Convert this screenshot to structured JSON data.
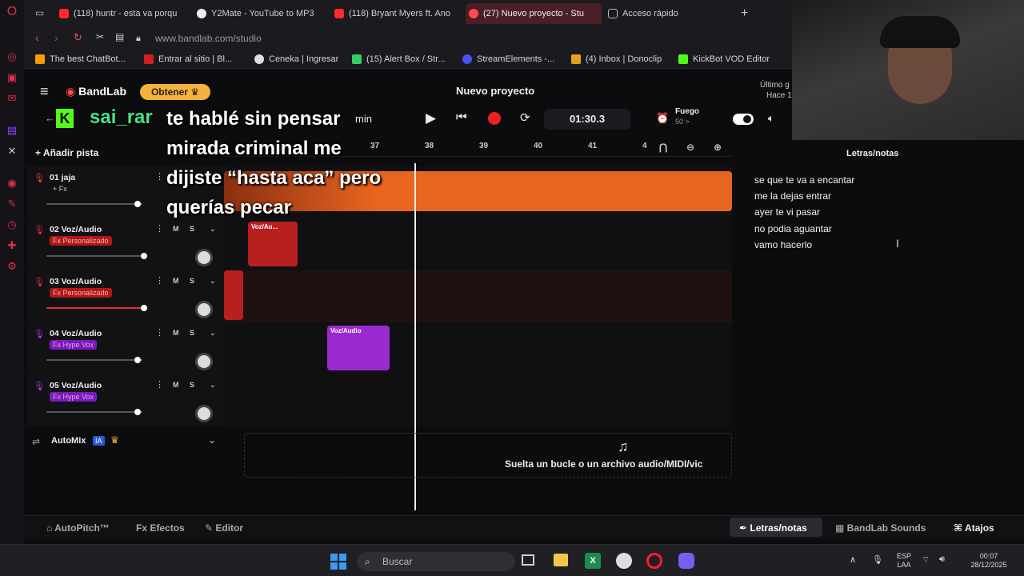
{
  "browser": {
    "tabs": [
      {
        "label": "(118) huntr - esta va porqu",
        "color": "#ff2a2a"
      },
      {
        "label": "Y2Mate - YouTube to MP3",
        "color": "#eeeeee"
      },
      {
        "label": "(118) Bryant Myers ft. Ano",
        "color": "#ff2a2a"
      },
      {
        "label": "(27) Nuevo proyecto - Stu",
        "color": "#ff4b4b"
      },
      {
        "label": "Acceso rápido",
        "color": "#bbbbbb"
      }
    ],
    "url": "www.bandlab.com/studio",
    "bookmarks": [
      {
        "label": "The best ChatBot...",
        "color": "#ff9900"
      },
      {
        "label": "Entrar al sitio | Bl...",
        "color": "#cc2222"
      },
      {
        "label": "Ceneka | Ingresar",
        "color": "#dddddd"
      },
      {
        "label": "(15) Alert Box / Str...",
        "color": "#33cc66"
      },
      {
        "label": "StreamElements -...",
        "color": "#4455ff"
      },
      {
        "label": "(4) Inbox | Donoclip",
        "color": "#e8a020"
      },
      {
        "label": "KickBot VOD Editor",
        "color": "#53fc18"
      }
    ]
  },
  "app": {
    "logo": "BandLab",
    "obtener": "Obtener",
    "title": "Nuevo proyecto",
    "last_saved_1": "Último g",
    "last_saved_2": "Hace 1",
    "time": "01:30.3",
    "tempo_label": "min",
    "fuego": "Fuego",
    "fuego_sub": "50 >",
    "add_track": "Añadir pista",
    "ruler": [
      "37",
      "38",
      "39",
      "40",
      "41",
      "4"
    ],
    "tracks": [
      {
        "name": "01 jaja",
        "fx": "+ Fx",
        "fxcolor": "#00000000",
        "fxtext": "#cccccc",
        "color": "#e14a2a",
        "mute": "",
        "solo": ""
      },
      {
        "name": "02 Voz/Audio",
        "fx": "Fx Personalizado",
        "fxcolor": "#b01818",
        "fxtext": "#ffb0b0",
        "color": "#e03030",
        "mute": "M",
        "solo": "S"
      },
      {
        "name": "03 Voz/Audio",
        "fx": "Fx Personalizado",
        "fxcolor": "#b01818",
        "fxtext": "#ffb0b0",
        "color": "#e03030",
        "mute": "M",
        "solo": "S"
      },
      {
        "name": "04 Voz/Audio",
        "fx": "Fx Hype Vox",
        "fxcolor": "#7a1ab8",
        "fxtext": "#e0a0ff",
        "color": "#b032e0",
        "mute": "M",
        "solo": "S"
      },
      {
        "name": "05 Voz/Audio",
        "fx": "Fx Hype Vox",
        "fxcolor": "#7a1ab8",
        "fxtext": "#e0a0ff",
        "color": "#b032e0",
        "mute": "M",
        "solo": "S"
      }
    ],
    "clip_label": "Voz/Au...",
    "clip_label2": "Voz/Audio",
    "automix": "AutoMix",
    "automix_badge": "IA",
    "drop_text": "Suelta un bucle o un archivo audio/MIDI/vic",
    "bottom": {
      "autopitch": "AutoPitch™",
      "efectos": "Efectos",
      "editor": "Editor",
      "notas": "Letras/notas",
      "sounds": "BandLab Sounds",
      "atajos": "Atajos"
    },
    "notes_title": "Letras/notas",
    "notes": [
      "se que te va a encantar",
      "me la dejas  entrar",
      "ayer te vi pasar",
      "no podia aguantar",
      "vamo hacerlo"
    ]
  },
  "stream": {
    "username": "sai_rar",
    "lyrics": [
      "te hablé sin pensar",
      "mirada criminal me",
      "dijiste “hasta aca” pero",
      "querías pecar"
    ]
  },
  "taskbar": {
    "search": "Buscar",
    "lang": "ESP",
    "lang2": "LAA",
    "time": "00:07",
    "date": "28/12/2025"
  }
}
